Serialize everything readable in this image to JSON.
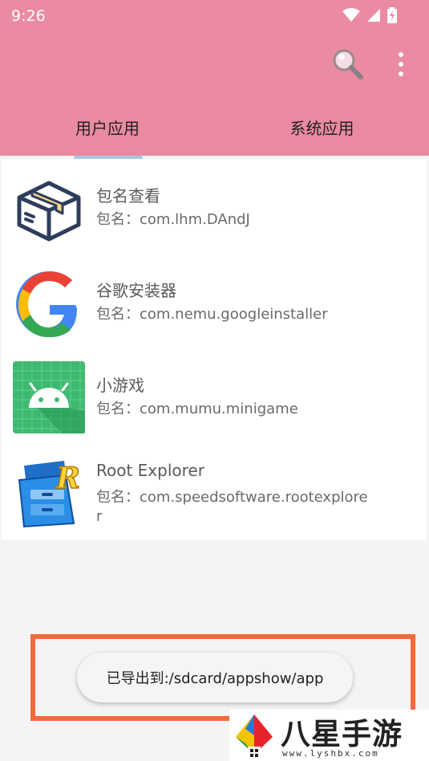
{
  "status_bar": {
    "time": "9:26"
  },
  "appbar": {
    "background": "#ea8ba2",
    "tabs": [
      {
        "label": "用户应用"
      },
      {
        "label": "系统应用"
      }
    ]
  },
  "apps": [
    {
      "name": "包名查看",
      "package_prefix": "包名：",
      "package": "com.lhm.DAndJ",
      "icon": "package-box-icon"
    },
    {
      "name": "谷歌安装器",
      "package_prefix": "包名：",
      "package": "com.nemu.googleinstaller",
      "icon": "google-g-icon"
    },
    {
      "name": "小游戏",
      "package_prefix": "包名：",
      "package": "com.mumu.minigame",
      "icon": "android-robot-icon"
    },
    {
      "name": "Root Explorer",
      "package_prefix": "包名：",
      "package": "com.speedsoftware.rootexplorer",
      "icon": "root-explorer-icon"
    }
  ],
  "toast": {
    "text": "已导出到:/sdcard/appshow/app"
  },
  "watermark": {
    "title": "八星手游网",
    "url": "www.lyshbx.com"
  }
}
